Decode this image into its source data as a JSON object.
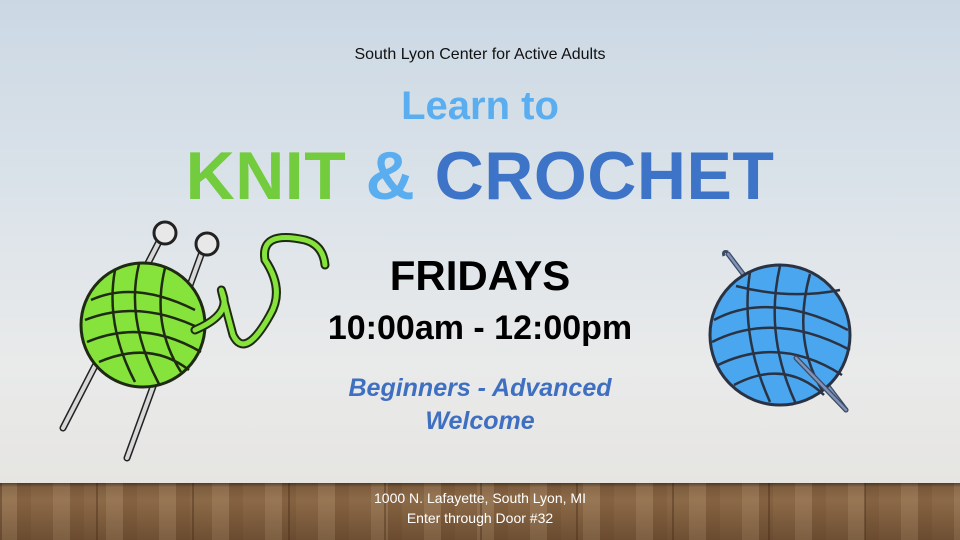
{
  "slide": {
    "organization": "South Lyon Center for Active Adults",
    "learn_line": "Learn to",
    "headline": {
      "knit": "KNIT",
      "amp": "&",
      "crochet": "CROCHET"
    },
    "day": "FRIDAYS",
    "time": "10:00am - 12:00pm",
    "level_line1": "Beginners - Advanced",
    "level_line2": "Welcome",
    "address_line1": "1000 N. Lafayette, South Lyon, MI",
    "address_line2": "Enter through Door #32"
  },
  "colors": {
    "knit_green": "#72cc3e",
    "amp_light_blue": "#5aaef0",
    "crochet_blue": "#3d74c8",
    "level_blue": "#3f6fc0"
  },
  "icons": [
    "yarn-ball-with-knitting-needles-icon",
    "yarn-ball-with-crochet-hook-icon"
  ]
}
